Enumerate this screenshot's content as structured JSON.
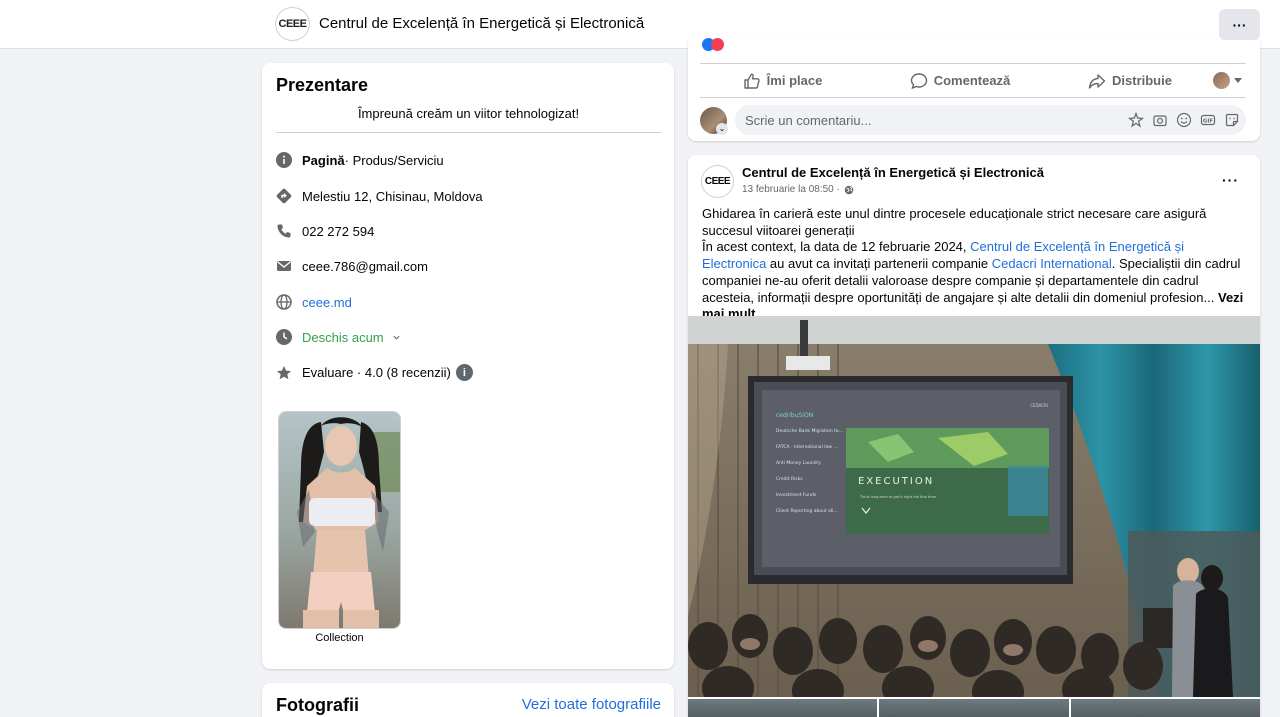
{
  "header": {
    "logo_text": "CEEE",
    "page_name": "Centrul de Excelență în Energetică și Electronică",
    "more_label": "···"
  },
  "intro": {
    "title": "Prezentare",
    "bio": "Împreună creăm un viitor tehnologizat!",
    "rows": {
      "category_strong": "Pagină",
      "category_rest": " · Produs/Serviciu",
      "address": "Melestiu 12, Chisinau, Moldova",
      "phone": "022 272 594",
      "email": "ceee.786@gmail.com",
      "website": "ceee.md",
      "hours": "Deschis acum",
      "rating": "Evaluare · 4.0 (8 recenzii)"
    },
    "collection_label": "Collection"
  },
  "photos": {
    "title": "Fotografii",
    "see_all": "Vezi toate fotografiile"
  },
  "post1": {
    "like": "Îmi place",
    "comment": "Comentează",
    "share": "Distribuie",
    "comment_placeholder": "Scrie un comentariu..."
  },
  "post2": {
    "author": "Centrul de Excelență în Energetică și Electronică",
    "avatar_text": "CEEE",
    "date": "13 februarie la 08:50 ·",
    "text_p1": "Ghidarea în carieră este unul dintre procesele educaționale strict necesare care asigură succesul viitoarei generații",
    "text_p2a": "În acest context, la data de 12 februarie 2024, ",
    "text_link1": "Centrul de Excelență în Energetică și Electronica",
    "text_p2b": " au avut ca invitați partenerii companie ",
    "text_link2": "Cedacri International",
    "text_p2c": ". Specialiștii din cadrul companiei ne-au oferit detalii valoroase despre companie și departamentele din cadrul acesteia, informații despre oportunități de angajare și alte detalii din domeniul profesion... ",
    "see_more": "Vezi mai mult",
    "slide_brand": "cedribuSiON",
    "slide_logo": "CEDACRI",
    "slide_items": [
      "Deutsche Bank Migration to Cedacri System",
      "FATCA - International law reporting reporting to bank of America",
      "Anti Money Laundry",
      "Credit Risks",
      "Investment Funds",
      "Client Reporting about all the commissions, fees the bank applies to them"
    ],
    "slide_title": "EXECUTION",
    "slide_caption": "Think long-term to get it right the first time"
  },
  "colors": {
    "link": "#216fdb",
    "green": "#31a24c",
    "muted": "#65676b",
    "background": "#f0f2f5"
  }
}
